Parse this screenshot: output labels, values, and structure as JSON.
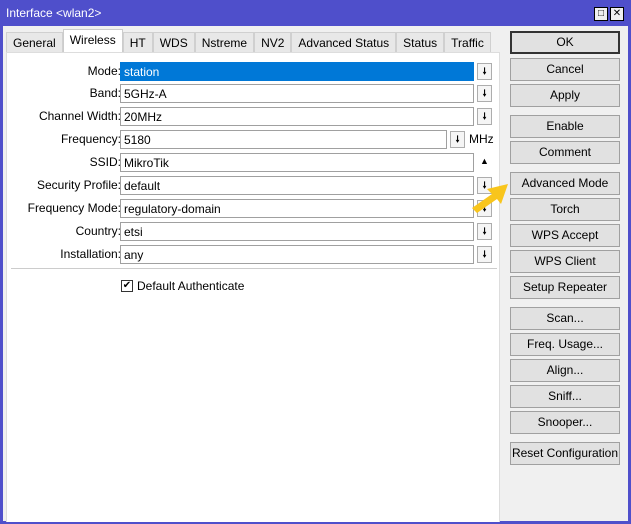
{
  "window": {
    "title": "Interface <wlan2>",
    "maximize_icon": "□",
    "close_icon": "✕"
  },
  "tabs": [
    "General",
    "Wireless",
    "HT",
    "WDS",
    "Nstreme",
    "NV2",
    "Advanced Status",
    "Status",
    "Traffic"
  ],
  "active_tab": "Wireless",
  "fields": [
    {
      "label": "Mode:",
      "value": "station",
      "control": "dropdown"
    },
    {
      "label": "Band:",
      "value": "5GHz-A",
      "control": "dropdown"
    },
    {
      "label": "Channel Width:",
      "value": "20MHz",
      "control": "dropdown"
    },
    {
      "label": "Frequency:",
      "value": "5180",
      "control": "dropdown",
      "unit": "MHz"
    },
    {
      "label": "SSID:",
      "value": "MikroTik",
      "control": "collapse"
    },
    {
      "label": "Security Profile:",
      "value": "default",
      "control": "dropdown"
    },
    {
      "label": "Frequency Mode:",
      "value": "regulatory-domain",
      "control": "dropdown"
    },
    {
      "label": "Country:",
      "value": "etsi",
      "control": "dropdown"
    },
    {
      "label": "Installation:",
      "value": "any",
      "control": "dropdown"
    }
  ],
  "checkbox": {
    "label": "Default Authenticate",
    "checked": true,
    "mark": "✔"
  },
  "buttons": [
    "OK",
    "Cancel",
    "Apply",
    "Enable",
    "Comment",
    "Advanced Mode",
    "Torch",
    "WPS Accept",
    "WPS Client",
    "Setup Repeater",
    "Scan...",
    "Freq. Usage...",
    "Align...",
    "Sniff...",
    "Snooper...",
    "Reset Configuration"
  ],
  "icons": {
    "dropdown": "🠗",
    "collapse": "▲"
  },
  "colors": {
    "titlebar": "#4f4fcb",
    "selection": "#0078d7",
    "arrow": "#f8c51c"
  }
}
